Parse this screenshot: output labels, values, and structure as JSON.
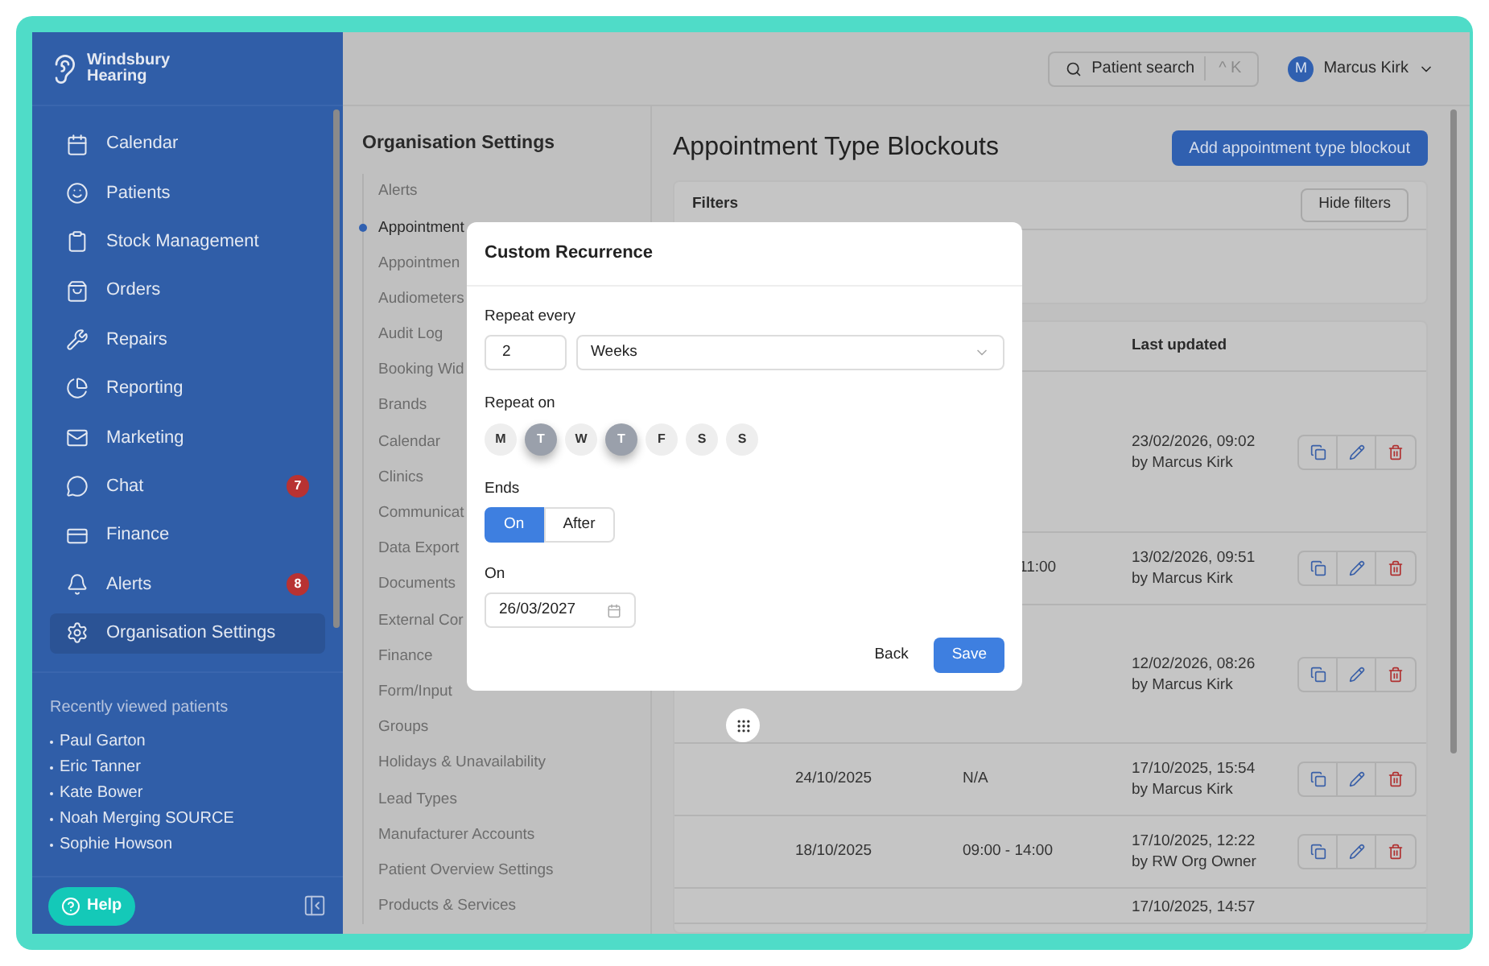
{
  "brand": {
    "name": "Windsbury Hearing"
  },
  "sidebar": {
    "items": [
      {
        "label": "Calendar",
        "selected": false
      },
      {
        "label": "Patients",
        "selected": false
      },
      {
        "label": "Stock Management",
        "selected": false
      },
      {
        "label": "Orders",
        "selected": false
      },
      {
        "label": "Repairs",
        "selected": false
      },
      {
        "label": "Reporting",
        "selected": false
      },
      {
        "label": "Marketing",
        "selected": false
      },
      {
        "label": "Chat",
        "selected": false,
        "badge": "7"
      },
      {
        "label": "Finance",
        "selected": false
      },
      {
        "label": "Alerts",
        "selected": false,
        "badge": "8"
      },
      {
        "label": "Organisation Settings",
        "selected": true
      }
    ]
  },
  "recent": {
    "title": "Recently viewed patients",
    "patients": [
      "Paul Garton",
      "Eric Tanner",
      "Kate Bower",
      "Noah Merging SOURCE",
      "Sophie Howson"
    ]
  },
  "help": "Help",
  "topbar": {
    "search": {
      "label": "Patient search",
      "shortcut": "^ K"
    },
    "user": {
      "initial": "M",
      "name": "Marcus Kirk"
    }
  },
  "settings": {
    "title": "Organisation Settings",
    "items": [
      {
        "label": "Alerts",
        "selected": false
      },
      {
        "label": "Appointment",
        "selected": true
      },
      {
        "label": "Appointmen",
        "selected": false
      },
      {
        "label": "Audiometers",
        "selected": false
      },
      {
        "label": "Audit Log",
        "selected": false
      },
      {
        "label": "Booking Wid",
        "selected": false
      },
      {
        "label": "Brands",
        "selected": false
      },
      {
        "label": "Calendar",
        "selected": false
      },
      {
        "label": "Clinics",
        "selected": false
      },
      {
        "label": "Communicat",
        "selected": false
      },
      {
        "label": "Data Export",
        "selected": false
      },
      {
        "label": "Documents",
        "selected": false
      },
      {
        "label": "External Cor",
        "selected": false
      },
      {
        "label": "Finance",
        "selected": false
      },
      {
        "label": "Form/Input",
        "selected": false
      },
      {
        "label": "Groups",
        "selected": false
      },
      {
        "label": "Holidays & Unavailability",
        "selected": false
      },
      {
        "label": "Lead Types",
        "selected": false
      },
      {
        "label": "Manufacturer Accounts",
        "selected": false
      },
      {
        "label": "Patient Overview Settings",
        "selected": false
      },
      {
        "label": "Products & Services",
        "selected": false
      }
    ]
  },
  "page": {
    "title": "Appointment Type Blockouts",
    "add_button": "Add appointment type blockout"
  },
  "filters": {
    "title": "Filters",
    "toggle": "Hide filters"
  },
  "table": {
    "columns": [
      "Last updated"
    ],
    "rows": [
      {
        "updated": "23/02/2026, 09:02",
        "by": "by Marcus Kirk"
      },
      {
        "time": "11:00",
        "updated": "13/02/2026, 09:51",
        "by": "by Marcus Kirk"
      },
      {
        "updated": "12/02/2026, 08:26",
        "by": "by Marcus Kirk"
      },
      {
        "date": "24/10/2025",
        "time": "N/A",
        "updated": "17/10/2025, 15:54",
        "by": "by Marcus Kirk"
      },
      {
        "date": "18/10/2025",
        "time": "09:00 - 14:00",
        "updated": "17/10/2025, 12:22",
        "by": "by RW Org Owner"
      },
      {
        "updated": "17/10/2025, 14:57"
      }
    ]
  },
  "modal": {
    "title": "Custom Recurrence",
    "repeat_every_label": "Repeat every",
    "interval": "2",
    "unit": "Weeks",
    "repeat_on_label": "Repeat on",
    "days": [
      {
        "label": "M",
        "selected": false
      },
      {
        "label": "T",
        "selected": true
      },
      {
        "label": "W",
        "selected": false
      },
      {
        "label": "T",
        "selected": true
      },
      {
        "label": "F",
        "selected": false
      },
      {
        "label": "S",
        "selected": false
      },
      {
        "label": "S",
        "selected": false
      }
    ],
    "ends_label": "Ends",
    "ends_options": [
      {
        "label": "On",
        "selected": true
      },
      {
        "label": "After",
        "selected": false
      }
    ],
    "on_label": "On",
    "date": "26/03/2027",
    "back": "Back",
    "save": "Save"
  }
}
